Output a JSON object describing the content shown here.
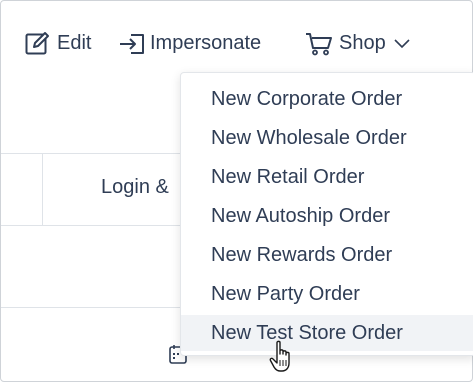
{
  "toolbar": {
    "edit_label": "Edit",
    "impersonate_label": "Impersonate",
    "shop_label": "Shop"
  },
  "background": {
    "column_header": "Login &"
  },
  "shop_menu": {
    "items": [
      {
        "label": "New Corporate Order"
      },
      {
        "label": "New Wholesale Order"
      },
      {
        "label": "New Retail Order"
      },
      {
        "label": "New Autoship Order"
      },
      {
        "label": "New Rewards Order"
      },
      {
        "label": "New Party Order"
      },
      {
        "label": "New Test Store Order"
      }
    ],
    "hovered_index": 6
  },
  "colors": {
    "text": "#2f3d55",
    "border": "#dfe3e8",
    "hover_bg": "#f1f3f6"
  }
}
